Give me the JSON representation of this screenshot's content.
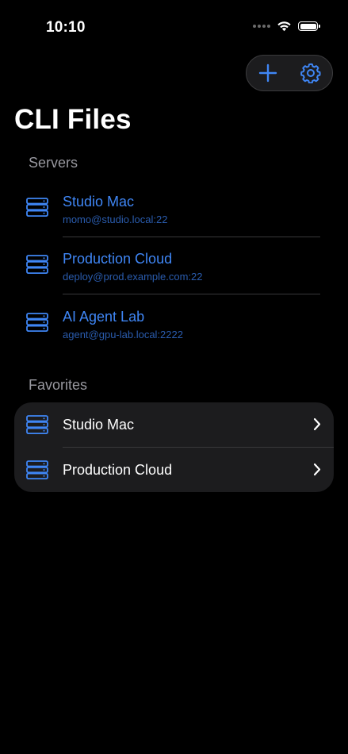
{
  "status_bar": {
    "time": "10:10"
  },
  "toolbar": {
    "add_icon": "plus-icon",
    "settings_icon": "gear-icon"
  },
  "title": "CLI Files",
  "accent_color": "#3f86f5",
  "servers": {
    "header": "Servers",
    "items": [
      {
        "name": "Studio Mac",
        "address": "momo@studio.local:22",
        "icon": "server-icon"
      },
      {
        "name": "Production Cloud",
        "address": "deploy@prod.example.com:22",
        "icon": "server-icon"
      },
      {
        "name": "AI Agent Lab",
        "address": "agent@gpu-lab.local:2222",
        "icon": "server-icon"
      }
    ]
  },
  "favorites": {
    "header": "Favorites",
    "items": [
      {
        "name": "Studio Mac",
        "icon": "server-icon"
      },
      {
        "name": "Production Cloud",
        "icon": "server-icon"
      }
    ]
  }
}
